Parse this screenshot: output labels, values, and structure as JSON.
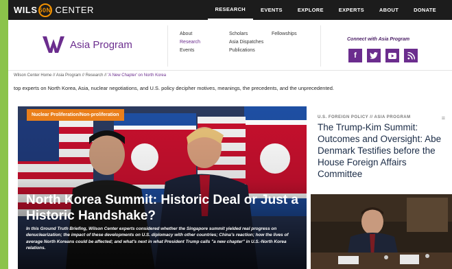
{
  "topbar": {
    "logo_pre": "WILS",
    "logo_fifty": "50N",
    "logo_post": "CENTER",
    "nav": [
      "RESEARCH",
      "EVENTS",
      "EXPLORE",
      "EXPERTS",
      "ABOUT",
      "DONATE"
    ]
  },
  "program": {
    "name": "Asia Program",
    "menu_col1": [
      "About",
      "Research",
      "Events"
    ],
    "menu_col2": [
      "Scholars",
      "Asia Dispatches",
      "Publications"
    ],
    "menu_col3": [
      "Fellowships"
    ],
    "connect_label": "Connect with Asia Program",
    "social_icons": [
      "facebook-icon",
      "twitter-icon",
      "youtube-icon",
      "rss-icon"
    ]
  },
  "breadcrumb": {
    "items": [
      "Wilson Center Home",
      "Asia Program",
      "Research",
      "'A New Chapter' on North Korea"
    ],
    "separator": " // "
  },
  "intro": "top experts on North Korea, Asia, nuclear negotiations, and U.S. policy decipher motives, meanings, the precedents, and the unprecedented.",
  "hero": {
    "tag": "Nuclear Proliferation/Non-proliferation",
    "title": "North Korea Summit: Historic Deal or Just a Historic Handshake?",
    "subtitle": "In this Ground Truth Briefing, Wilson Center experts considered whether the Singapore summit yielded real progress on denuclearization; the impact of these developments on U.S. diplomacy with other countries; China's reaction; how the lives of average North Koreans could be affected; and what's next in what President Trump calls \"a new chapter\" in U.S.-North Korea relations."
  },
  "side": {
    "meta": "U.S. FOREIGN POLICY  //  ASIA PROGRAM",
    "title": "The Trump-Kim Summit: Outcomes and Oversight: Abe Denmark Testifies before the House Foreign Affairs Committee"
  },
  "colors": {
    "brand_purple": "#6b2d8e",
    "tag_orange": "#ea7f1a",
    "topbar": "#1c1c1c",
    "edge_green": "#8bc34a"
  }
}
